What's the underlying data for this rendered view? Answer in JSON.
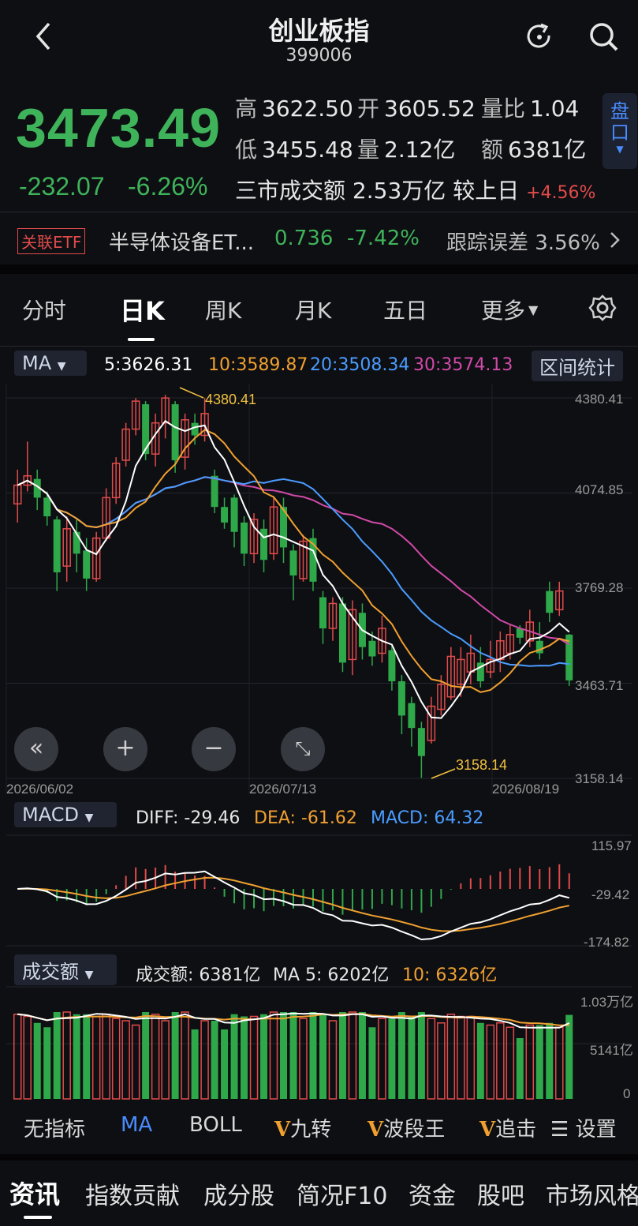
{
  "header": {
    "title": "创业板指",
    "code": "399006"
  },
  "quote": {
    "price": "3473.49",
    "change": "-232.07",
    "change_pct": "-6.26%",
    "high_label": "高",
    "high": "3622.50",
    "open_label": "开",
    "open": "3605.52",
    "vol_ratio_label": "量比",
    "vol_ratio": "1.04",
    "low_label": "低",
    "low": "3455.48",
    "volume_label": "量",
    "volume": "2.12亿",
    "amount_label": "额",
    "amount": "6381亿",
    "market_turnover_label": "三市成交额",
    "market_turnover": "2.53万亿",
    "vs_prev_label": "较上日",
    "vs_prev": "+4.56%",
    "panko_label": "盘口"
  },
  "etf": {
    "tag": "关联ETF",
    "name": "半导体设备ET...",
    "price": "0.736",
    "pct": "-7.42%",
    "tracking": "跟踪误差 3.56%"
  },
  "tabs": [
    "分时",
    "日K",
    "周K",
    "月K",
    "五日",
    "更多"
  ],
  "ma_legend": {
    "selector": "MA",
    "ma5": "5:3626.31",
    "ma10": "10:3589.87",
    "ma20": "20:3508.34",
    "ma30": "30:3574.13",
    "stats_button": "区间统计"
  },
  "price_axis": [
    "4380.41",
    "4074.85",
    "3769.28",
    "3463.71",
    "3158.14"
  ],
  "date_axis": [
    "2026/06/02",
    "2026/07/13",
    "2026/08/19"
  ],
  "annotations": {
    "high": "4380.41",
    "low": "3158.14"
  },
  "macd_legend": {
    "selector": "MACD",
    "diff": "DIFF: -29.46",
    "dea": "DEA: -61.62",
    "macd": "MACD: 64.32",
    "axis": [
      "115.97",
      "-29.42",
      "-174.82"
    ]
  },
  "turnover_legend": {
    "selector": "成交额",
    "amount": "成交额: 6381亿",
    "ma5": "MA 5: 6202亿",
    "ma10": "10: 6326亿",
    "axis": [
      "1.03万亿",
      "5141亿",
      "0"
    ]
  },
  "indicator_bar": {
    "none": "无指标",
    "ma": "MA",
    "boll": "BOLL",
    "jiuzhuan": "九转",
    "boduan": "波段王",
    "zhuiji": "追击",
    "settings": "设置"
  },
  "bottom_nav": [
    "资讯",
    "指数贡献",
    "成分股",
    "简况F10",
    "资金",
    "股吧",
    "市场风格"
  ],
  "colors": {
    "up": "#e04b4b",
    "down": "#2fa84a",
    "ma5": "#ffffff",
    "ma10": "#f0a030",
    "ma20": "#4a9cff",
    "ma30": "#d04aa8",
    "accent": "#4a8cff"
  },
  "chart_data": {
    "type": "candlestick",
    "price_range": [
      3158.14,
      4380.41
    ],
    "candles": [
      [
        4040,
        4100,
        3980,
        4150
      ],
      [
        4100,
        4130,
        4080,
        4240
      ],
      [
        4120,
        4060,
        4020,
        4150
      ],
      [
        4060,
        4000,
        3970,
        4080
      ],
      [
        3990,
        3820,
        3760,
        4000
      ],
      [
        3840,
        3960,
        3790,
        4000
      ],
      [
        3950,
        3880,
        3820,
        3990
      ],
      [
        3890,
        3800,
        3760,
        3930
      ],
      [
        3800,
        3930,
        3790,
        3950
      ],
      [
        3930,
        4060,
        3920,
        4090
      ],
      [
        4060,
        4170,
        4040,
        4190
      ],
      [
        4180,
        4280,
        4160,
        4300
      ],
      [
        4280,
        4370,
        4260,
        4380
      ],
      [
        4360,
        4200,
        4180,
        4370
      ],
      [
        4200,
        4300,
        4160,
        4330
      ],
      [
        4300,
        4380,
        4250,
        4390
      ],
      [
        4360,
        4180,
        4140,
        4370
      ],
      [
        4190,
        4310,
        4150,
        4330
      ],
      [
        4300,
        4260,
        4230,
        4330
      ],
      [
        4260,
        4330,
        4240,
        4380
      ],
      [
        4130,
        4030,
        4010,
        4150
      ],
      [
        4030,
        3980,
        3960,
        4060
      ],
      [
        4060,
        3950,
        3900,
        4070
      ],
      [
        3980,
        3880,
        3840,
        4000
      ],
      [
        3880,
        3990,
        3850,
        4010
      ],
      [
        3960,
        3860,
        3820,
        3990
      ],
      [
        3880,
        4030,
        3860,
        4060
      ],
      [
        4030,
        3900,
        3850,
        4060
      ],
      [
        3890,
        3810,
        3730,
        3910
      ],
      [
        3800,
        3920,
        3790,
        3940
      ],
      [
        3930,
        3790,
        3760,
        3960
      ],
      [
        3740,
        3640,
        3590,
        3760
      ],
      [
        3640,
        3720,
        3600,
        3740
      ],
      [
        3720,
        3530,
        3500,
        3740
      ],
      [
        3540,
        3700,
        3490,
        3730
      ],
      [
        3690,
        3580,
        3540,
        3720
      ],
      [
        3600,
        3550,
        3520,
        3630
      ],
      [
        3560,
        3640,
        3530,
        3680
      ],
      [
        3570,
        3470,
        3440,
        3590
      ],
      [
        3470,
        3360,
        3300,
        3490
      ],
      [
        3400,
        3320,
        3260,
        3420
      ],
      [
        3320,
        3230,
        3160,
        3340
      ],
      [
        3280,
        3390,
        3270,
        3420
      ],
      [
        3380,
        3460,
        3360,
        3490
      ],
      [
        3420,
        3550,
        3410,
        3580
      ],
      [
        3460,
        3540,
        3420,
        3580
      ],
      [
        3500,
        3560,
        3460,
        3620
      ],
      [
        3530,
        3470,
        3450,
        3580
      ],
      [
        3500,
        3540,
        3480,
        3600
      ],
      [
        3540,
        3600,
        3500,
        3630
      ],
      [
        3560,
        3620,
        3540,
        3650
      ],
      [
        3640,
        3610,
        3590,
        3650
      ],
      [
        3600,
        3660,
        3580,
        3700
      ],
      [
        3600,
        3560,
        3540,
        3660
      ],
      [
        3760,
        3690,
        3660,
        3790
      ],
      [
        3700,
        3760,
        3680,
        3790
      ],
      [
        3620,
        3473,
        3455,
        3622
      ]
    ]
  }
}
